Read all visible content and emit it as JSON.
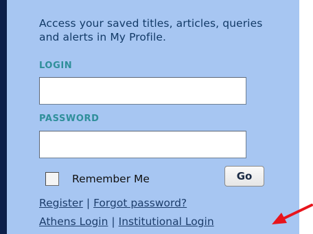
{
  "intro_text": "Access your saved titles, articles, queries and alerts in My Profile.",
  "login": {
    "label": "LOGIN",
    "value": "",
    "placeholder": ""
  },
  "password": {
    "label": "PASSWORD",
    "value": "",
    "placeholder": ""
  },
  "remember_me": {
    "label": "Remember Me",
    "checked": false
  },
  "go_button": "Go",
  "links": {
    "register": "Register",
    "forgot_password": "Forgot password?",
    "athens_login": "Athens Login",
    "institutional_login": "Institutional Login",
    "separator": "|"
  },
  "annotation": {
    "arrow_color": "#e8141c",
    "arrow_target": "institutional-login-link"
  },
  "colors": {
    "panel_bg": "#a7c6f2",
    "left_bar": "#0b1f4a",
    "label_teal": "#2f8f9a",
    "link_text": "#1c3d6b"
  }
}
